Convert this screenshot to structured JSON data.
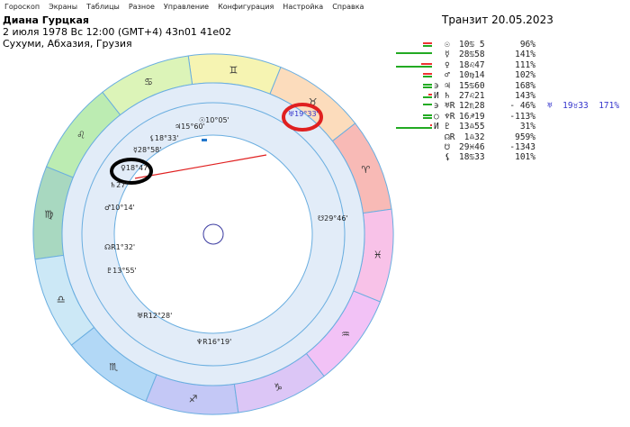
{
  "menu": [
    "Гороскоп",
    "Экраны",
    "Таблицы",
    "Разное",
    "Управление",
    "Конфигурация",
    "Настройка",
    "Справка"
  ],
  "header": {
    "name": "Диана Гурцкая",
    "birth": "2 июля 1978  Вс  12:00 (GMT+4) 43n01  41e02",
    "place": "Сухуми, Абхазия, Грузия"
  },
  "transit_title": "Транзит 20.05.2023",
  "table": [
    {
      "aspect": " ",
      "planet": "☉",
      "pos": "10♋ 5",
      "pct": "96%",
      "bars": [
        [
          "#e33",
          10
        ],
        [
          "#2a2",
          10
        ]
      ]
    },
    {
      "aspect": " ",
      "planet": "☿",
      "pos": "28♋58",
      "pct": "141%",
      "bars": [
        [
          "#2a2",
          40
        ]
      ]
    },
    {
      "aspect": " ",
      "planet": "♀",
      "pos": "18♌47",
      "pct": "111%",
      "bars": [
        [
          "#e33",
          12
        ],
        [
          "#2a2",
          40
        ]
      ]
    },
    {
      "aspect": " ",
      "planet": "♂",
      "pos": "10♍14",
      "pct": "102%",
      "bars": [
        [
          "#e33",
          10
        ],
        [
          "#2a2",
          10
        ]
      ]
    },
    {
      "aspect": "϶",
      "planet": "♃",
      "pos": "15♋60",
      "pct": "168%",
      "bars": [
        [
          "#2a2",
          10
        ],
        [
          "#2a2",
          10
        ]
      ]
    },
    {
      "aspect": "И",
      "planet": "♄",
      "pos": "27♌21",
      "pct": "143%",
      "bars": [
        [
          "#e33",
          4
        ],
        [
          "#2a2",
          10
        ]
      ]
    },
    {
      "aspect": "϶",
      "planet": "♅R",
      "pos": "12♏28",
      "pct": "- 46%",
      "bars": [
        [
          "#2a2",
          10
        ]
      ],
      "extra": "♅  19♉33  171%"
    },
    {
      "aspect": "○",
      "planet": "♆R",
      "pos": "16♐19",
      "pct": "-113%",
      "bars": [
        [
          "#2a2",
          10
        ],
        [
          "#2a2",
          10
        ]
      ]
    },
    {
      "aspect": "И",
      "planet": "♇",
      "pos": "13♎55",
      "pct": "31%",
      "bars": [
        [
          "#e33",
          2
        ],
        [
          "#2a2",
          40
        ]
      ]
    },
    {
      "aspect": " ",
      "planet": "☊R",
      "pos": " 1♎32",
      "pct": "959%",
      "bars": []
    },
    {
      "aspect": " ",
      "planet": "☋",
      "pos": "29♓46",
      "pct": "-1343",
      "bars": []
    },
    {
      "aspect": " ",
      "planet": "⚸",
      "pos": "18♋33",
      "pct": "101%",
      "bars": []
    }
  ],
  "signs": [
    {
      "glyph": "♈",
      "color": "#f8bab6"
    },
    {
      "glyph": "♉",
      "color": "#fcdcbc"
    },
    {
      "glyph": "♊",
      "color": "#f6f4b2"
    },
    {
      "glyph": "♋",
      "color": "#dcf4b8"
    },
    {
      "glyph": "♌",
      "color": "#bcecb2"
    },
    {
      "glyph": "♍",
      "color": "#a8d8c0"
    },
    {
      "glyph": "♎",
      "color": "#cce8f6"
    },
    {
      "glyph": "♏",
      "color": "#b2d8f6"
    },
    {
      "glyph": "♐",
      "color": "#c4c8f6"
    },
    {
      "glyph": "♑",
      "color": "#dcc6f6"
    },
    {
      "glyph": "♒",
      "color": "#f2c2f6"
    },
    {
      "glyph": "♓",
      "color": "#f8c2e8"
    }
  ],
  "planets": {
    "sun": "☉10°05'",
    "jupiter": "♃15°60'",
    "lilith": "⚸18°33'",
    "mercury": "☿28°58'",
    "venus": "♀18°47'",
    "saturn": "♄27°",
    "mars": "♂10°14'",
    "node": "☊R1°32'",
    "pluto": "♇13°55'",
    "uranus": "♅R12°28'",
    "neptune": "♆R16°19'",
    "south_node": "☋29°46'",
    "transit_uranus": "♅19°33'"
  },
  "colors": {
    "highlight_red": "#e02020",
    "highlight_black": "#000000",
    "transit": "#3333cc"
  }
}
